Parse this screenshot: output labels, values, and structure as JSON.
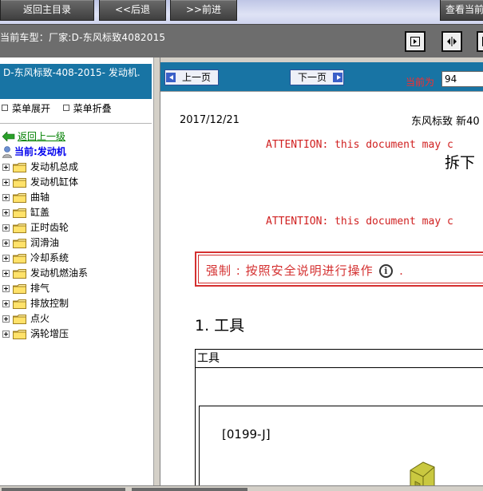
{
  "toolbar": {
    "back_main": "返回主目录",
    "back": "<<后退",
    "forward": ">>前进",
    "view_current": "查看当前"
  },
  "vehicle": {
    "label": "当前车型：厂家:D-东风标致4082015"
  },
  "sidebar": {
    "title": "D-东风标致-408-2015- 发动机.",
    "expand": "菜单展开",
    "collapse": "菜单折叠",
    "back_up": "返回上一级",
    "current": "当前:发动机",
    "items": [
      {
        "label": "发动机总成"
      },
      {
        "label": "发动机缸体"
      },
      {
        "label": "曲轴"
      },
      {
        "label": "缸盖"
      },
      {
        "label": "正时齿轮"
      },
      {
        "label": "润滑油"
      },
      {
        "label": "冷却系统"
      },
      {
        "label": "发动机燃油系"
      },
      {
        "label": "排气"
      },
      {
        "label": "排放控制"
      },
      {
        "label": "点火"
      },
      {
        "label": "涡轮增压"
      }
    ]
  },
  "pager": {
    "prev": "上一页",
    "next": "下一页",
    "current_label": "当前为",
    "current_value": "94"
  },
  "document": {
    "date": "2017/12/21",
    "brand": "东风标致 新40",
    "attention": "ATTENTION: this document may c",
    "title": "拆下",
    "warning": "强制 : 按照安全说明进行操作",
    "warning_end": ".",
    "info_symbol": "i",
    "section": "1.  工具",
    "table_header": "工具",
    "tool_code": "[0199-J]"
  },
  "colors": {
    "nav_blue": "#1874a4",
    "warning_red": "#d43030",
    "link_green": "#008000",
    "current_blue": "#0000ee"
  }
}
